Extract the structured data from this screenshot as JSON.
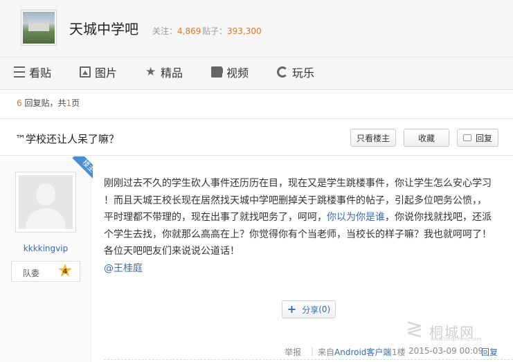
{
  "header": {
    "forum_name": "天城中学吧",
    "follow_label": "关注：",
    "follow_count": "4,869",
    "posts_label": "贴子：",
    "posts_count": "393,300"
  },
  "nav": {
    "tabs": [
      {
        "label": "看贴",
        "icon": "list-icon"
      },
      {
        "label": "图片",
        "icon": "image-icon"
      },
      {
        "label": "精品",
        "icon": "star-icon"
      },
      {
        "label": "视频",
        "icon": "video-icon"
      },
      {
        "label": "玩乐",
        "icon": "game-icon"
      }
    ]
  },
  "thread_info": {
    "reply_count": "6",
    "reply_text": "回复贴，共",
    "page_count": "1",
    "page_suffix": "页"
  },
  "thread": {
    "title": "™学校还让人呆了嘛？",
    "only_op_label": "只看楼主",
    "favorite_label": "收藏",
    "reply_label": "回复"
  },
  "post": {
    "op_badge": "楼主",
    "username": "kkkkingvip",
    "rank_title": "队委",
    "rank_level": "4",
    "content_line1": "刚刚过去不久的学生砍人事件还历历在目，现在又是学生跳楼事件，你让学生怎么安心学习",
    "content_line2": "！而且天城王校长现在居然找天城中学吧删掉关于跳楼事件的帖子，引起多位吧务公愤，，",
    "content_line3a": "平时理都不带理的，现在出事了就找吧务了，呵呵，",
    "content_line3_link": "你以为你是谁",
    "content_line3b": "，你说你找就找吧，还派",
    "content_line4": "个学生去找，你就那么高高在上？你觉得你有个当老师，当校长的样子嘛？我也就呵呵了！",
    "content_line5": "各位天吧吧友们来说说公道话！",
    "mention": "@王桂庭",
    "share_label": "分享",
    "share_count": "(0)"
  },
  "footer": {
    "report": "举报",
    "separator": "|",
    "from_prefix": "来自",
    "client": "Android客户端",
    "floor": "1楼",
    "time": "2015-03-09 00:09",
    "reply": "回复"
  },
  "watermark": {
    "brand": "桐城网",
    "url": "www.tongcheng.com"
  }
}
